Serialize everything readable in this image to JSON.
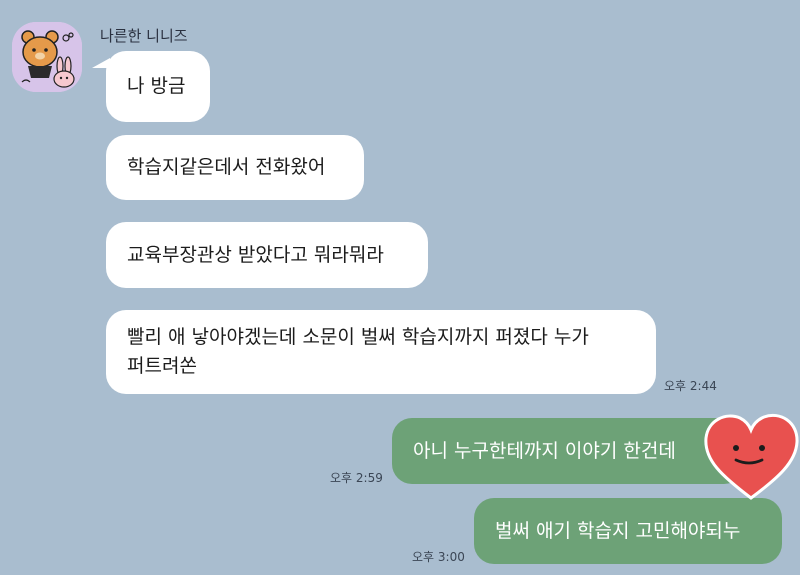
{
  "chat": {
    "sender_name": "나른한 니니즈",
    "incoming": [
      {
        "text": "나 방금"
      },
      {
        "text": "학습지같은데서 전화왔어"
      },
      {
        "text": "교육부장관상 받았다고 뭐라뭐라"
      },
      {
        "line1": "빨리 애 낳아야겠는데 소문이 벌써 학습지까지 퍼졌다 누가",
        "line2": "퍼트려쏜",
        "time": "오후 2:44"
      }
    ],
    "outgoing": [
      {
        "text": "아니 누구한테까지 이야기 한건데",
        "time": "오후 2:59"
      },
      {
        "text": "벌써 애기 학습지 고민해야되누",
        "time": "오후 3:00"
      }
    ]
  },
  "colors": {
    "background": "#a9bdcf",
    "incoming_bubble": "#ffffff",
    "outgoing_bubble": "#6da277",
    "heart": "#e8514f"
  },
  "icons": {
    "avatar": "ninis-characters-avatar",
    "sticker": "smiling-heart-sticker"
  }
}
